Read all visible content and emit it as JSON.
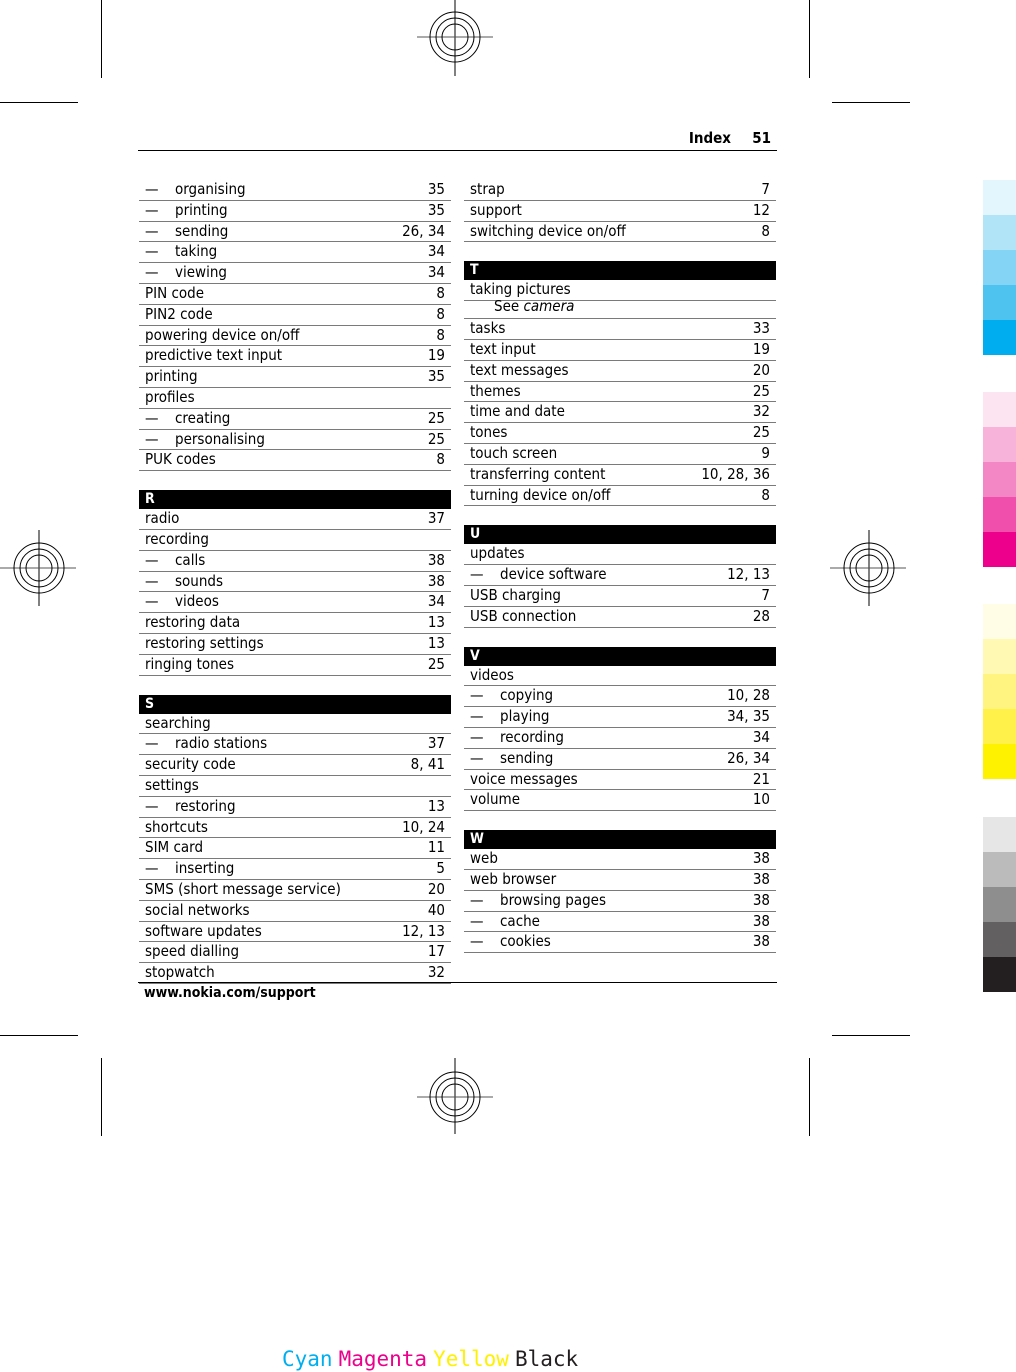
{
  "header": {
    "title": "Index",
    "page_number": "51"
  },
  "footer": {
    "url": "www.nokia.com/support"
  },
  "left_column": [
    {
      "type": "entry",
      "sub": true,
      "term": "organising",
      "pages": "35"
    },
    {
      "type": "entry",
      "sub": true,
      "term": "printing",
      "pages": "35"
    },
    {
      "type": "entry",
      "sub": true,
      "term": "sending",
      "pages": "26, 34"
    },
    {
      "type": "entry",
      "sub": true,
      "term": "taking",
      "pages": "34"
    },
    {
      "type": "entry",
      "sub": true,
      "term": "viewing",
      "pages": "34"
    },
    {
      "type": "entry",
      "sub": false,
      "term": "PIN code",
      "pages": "8"
    },
    {
      "type": "entry",
      "sub": false,
      "term": "PIN2 code",
      "pages": "8"
    },
    {
      "type": "entry",
      "sub": false,
      "term": "powering device on/off",
      "pages": "8"
    },
    {
      "type": "entry",
      "sub": false,
      "term": "predictive text input",
      "pages": "19"
    },
    {
      "type": "entry",
      "sub": false,
      "term": "printing",
      "pages": "35"
    },
    {
      "type": "entry",
      "sub": false,
      "term": "profiles",
      "pages": ""
    },
    {
      "type": "entry",
      "sub": true,
      "term": "creating",
      "pages": "25"
    },
    {
      "type": "entry",
      "sub": true,
      "term": "personalising",
      "pages": "25"
    },
    {
      "type": "entry",
      "sub": false,
      "term": "PUK codes",
      "pages": "8"
    },
    {
      "type": "letter",
      "label": "R"
    },
    {
      "type": "entry",
      "sub": false,
      "term": "radio",
      "pages": "37"
    },
    {
      "type": "entry",
      "sub": false,
      "term": "recording",
      "pages": ""
    },
    {
      "type": "entry",
      "sub": true,
      "term": "calls",
      "pages": "38"
    },
    {
      "type": "entry",
      "sub": true,
      "term": "sounds",
      "pages": "38"
    },
    {
      "type": "entry",
      "sub": true,
      "term": "videos",
      "pages": "34"
    },
    {
      "type": "entry",
      "sub": false,
      "term": "restoring data",
      "pages": "13"
    },
    {
      "type": "entry",
      "sub": false,
      "term": "restoring settings",
      "pages": "13"
    },
    {
      "type": "entry",
      "sub": false,
      "term": "ringing tones",
      "pages": "25"
    },
    {
      "type": "letter",
      "label": "S"
    },
    {
      "type": "entry",
      "sub": false,
      "term": "searching",
      "pages": ""
    },
    {
      "type": "entry",
      "sub": true,
      "term": "radio stations",
      "pages": "37"
    },
    {
      "type": "entry",
      "sub": false,
      "term": "security code",
      "pages": "8, 41"
    },
    {
      "type": "entry",
      "sub": false,
      "term": "settings",
      "pages": ""
    },
    {
      "type": "entry",
      "sub": true,
      "term": "restoring",
      "pages": "13"
    },
    {
      "type": "entry",
      "sub": false,
      "term": "shortcuts",
      "pages": "10, 24"
    },
    {
      "type": "entry",
      "sub": false,
      "term": "SIM card",
      "pages": "11"
    },
    {
      "type": "entry",
      "sub": true,
      "term": "inserting",
      "pages": "5"
    },
    {
      "type": "entry",
      "sub": false,
      "term": "SMS (short message service)",
      "pages": "20"
    },
    {
      "type": "entry",
      "sub": false,
      "term": "social networks",
      "pages": "40"
    },
    {
      "type": "entry",
      "sub": false,
      "term": "software updates",
      "pages": "12, 13"
    },
    {
      "type": "entry",
      "sub": false,
      "term": "speed dialling",
      "pages": "17"
    },
    {
      "type": "entry",
      "sub": false,
      "term": "stopwatch",
      "pages": "32"
    }
  ],
  "right_column": [
    {
      "type": "entry",
      "sub": false,
      "term": "strap",
      "pages": "7"
    },
    {
      "type": "entry",
      "sub": false,
      "term": "support",
      "pages": "12"
    },
    {
      "type": "entry",
      "sub": false,
      "term": "switching device on/off",
      "pages": "8"
    },
    {
      "type": "letter",
      "label": "T"
    },
    {
      "type": "entry",
      "sub": false,
      "term": "taking pictures",
      "pages": "",
      "nobottom": true
    },
    {
      "type": "see",
      "see_label": "See",
      "see_target": "camera"
    },
    {
      "type": "entry",
      "sub": false,
      "term": "tasks",
      "pages": "33"
    },
    {
      "type": "entry",
      "sub": false,
      "term": "text input",
      "pages": "19"
    },
    {
      "type": "entry",
      "sub": false,
      "term": "text messages",
      "pages": "20"
    },
    {
      "type": "entry",
      "sub": false,
      "term": "themes",
      "pages": "25"
    },
    {
      "type": "entry",
      "sub": false,
      "term": "time and date",
      "pages": "32"
    },
    {
      "type": "entry",
      "sub": false,
      "term": "tones",
      "pages": "25"
    },
    {
      "type": "entry",
      "sub": false,
      "term": "touch screen",
      "pages": "9"
    },
    {
      "type": "entry",
      "sub": false,
      "term": "transferring content",
      "pages": "10, 28, 36"
    },
    {
      "type": "entry",
      "sub": false,
      "term": "turning device on/off",
      "pages": "8"
    },
    {
      "type": "letter",
      "label": "U"
    },
    {
      "type": "entry",
      "sub": false,
      "term": "updates",
      "pages": ""
    },
    {
      "type": "entry",
      "sub": true,
      "term": "device software",
      "pages": "12, 13"
    },
    {
      "type": "entry",
      "sub": false,
      "term": "USB charging",
      "pages": "7"
    },
    {
      "type": "entry",
      "sub": false,
      "term": "USB connection",
      "pages": "28"
    },
    {
      "type": "letter",
      "label": "V"
    },
    {
      "type": "entry",
      "sub": false,
      "term": "videos",
      "pages": ""
    },
    {
      "type": "entry",
      "sub": true,
      "term": "copying",
      "pages": "10, 28"
    },
    {
      "type": "entry",
      "sub": true,
      "term": "playing",
      "pages": "34, 35"
    },
    {
      "type": "entry",
      "sub": true,
      "term": "recording",
      "pages": "34"
    },
    {
      "type": "entry",
      "sub": true,
      "term": "sending",
      "pages": "26, 34"
    },
    {
      "type": "entry",
      "sub": false,
      "term": "voice messages",
      "pages": "21"
    },
    {
      "type": "entry",
      "sub": false,
      "term": "volume",
      "pages": "10"
    },
    {
      "type": "letter",
      "label": "W"
    },
    {
      "type": "entry",
      "sub": false,
      "term": "web",
      "pages": "38"
    },
    {
      "type": "entry",
      "sub": false,
      "term": "web browser",
      "pages": "38"
    },
    {
      "type": "entry",
      "sub": true,
      "term": "browsing pages",
      "pages": "38"
    },
    {
      "type": "entry",
      "sub": true,
      "term": "cache",
      "pages": "38"
    },
    {
      "type": "entry",
      "sub": true,
      "term": "cookies",
      "pages": "38"
    }
  ],
  "color_bar": {
    "cyan": [
      "#e3f5fd",
      "#b2e4f7",
      "#83d4f5",
      "#4ec3ef",
      "#00aeef"
    ],
    "magenta": [
      "#fce4f1",
      "#f8b3da",
      "#f386c4",
      "#f04fab",
      "#ec008c"
    ],
    "yellow": [
      "#fffde6",
      "#fff9b3",
      "#fff47f",
      "#fff04a",
      "#fff200"
    ],
    "black": [
      "#e6e6e6",
      "#bbbbbb",
      "#8f8e8e",
      "#626061",
      "#231f20"
    ]
  },
  "cmyk_label": [
    {
      "text": "Cyan",
      "color": "#00aeef"
    },
    {
      "text": "Magenta",
      "color": "#ec008c"
    },
    {
      "text": "Yellow",
      "color": "#fff200"
    },
    {
      "text": "Black",
      "color": "#231f20"
    }
  ],
  "dash_glyph": "—"
}
